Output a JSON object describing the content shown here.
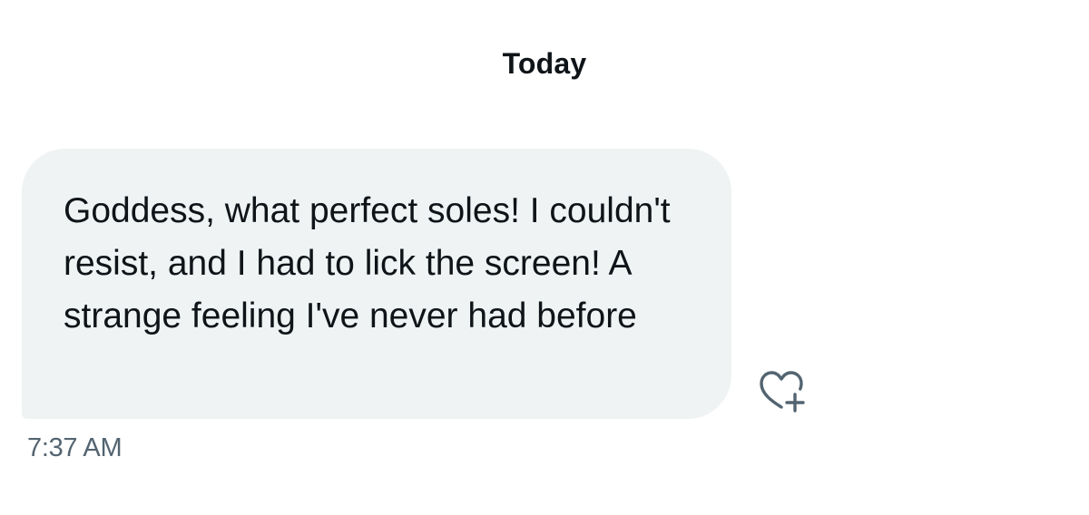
{
  "conversation": {
    "date_divider": "Today",
    "message": {
      "text": "Goddess, what perfect soles! I couldn't resist, and I had to lick the screen! A strange feeling I've never had before",
      "timestamp": "7:37 AM"
    },
    "reaction_button": {
      "icon": "heart-plus-icon"
    }
  },
  "colors": {
    "bubble_background": "#eff3f4",
    "text_primary": "#0f1419",
    "text_secondary": "#536471"
  }
}
